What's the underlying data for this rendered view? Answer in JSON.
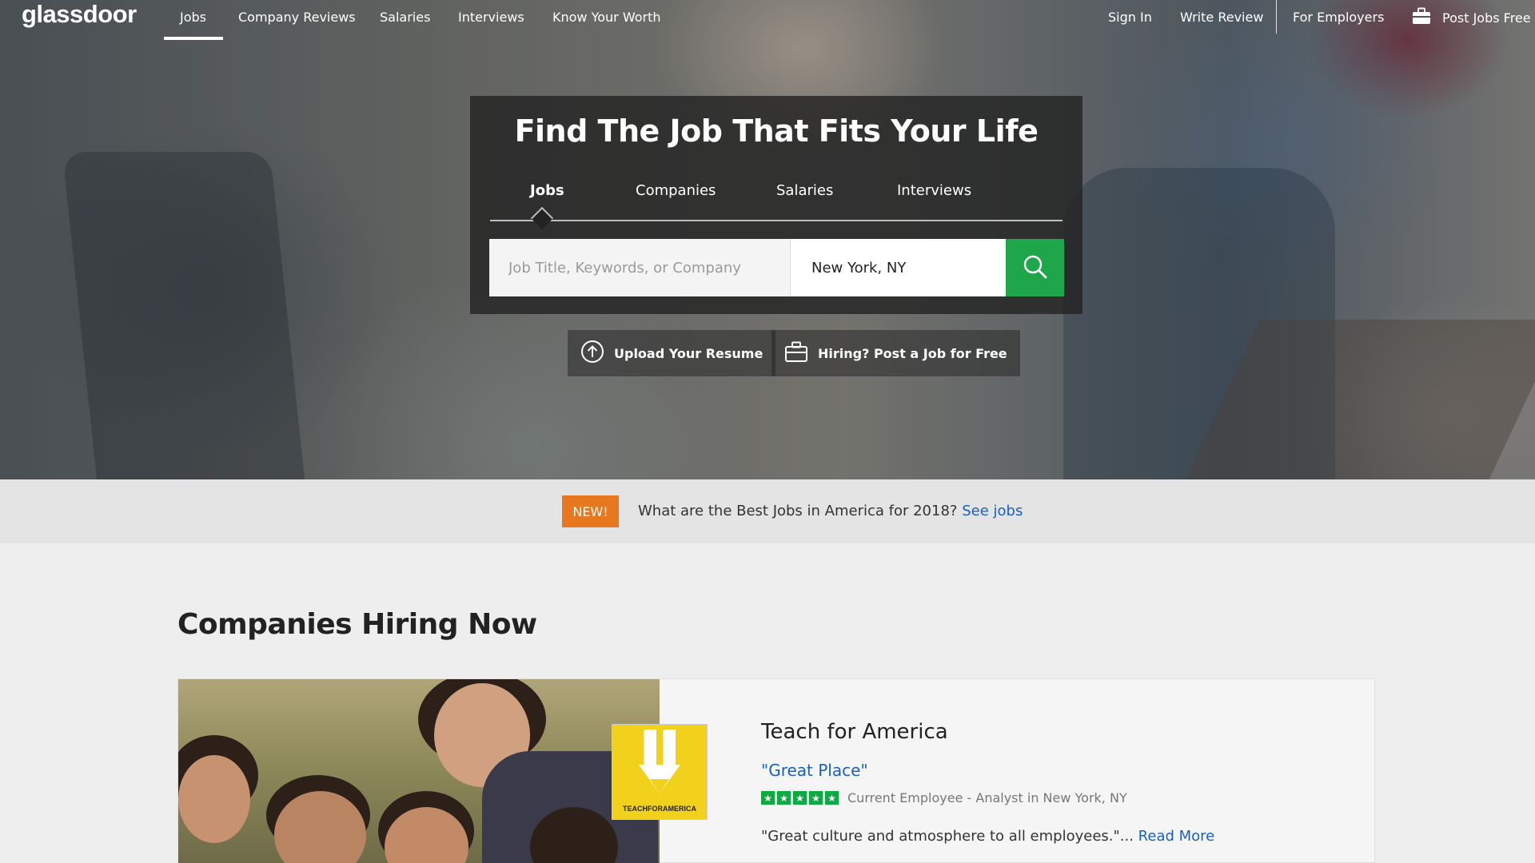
{
  "nav": {
    "logo": "glassdoor",
    "items": [
      "Jobs",
      "Company Reviews",
      "Salaries",
      "Interviews",
      "Know Your Worth"
    ],
    "active": "Jobs",
    "sign_in": "Sign In",
    "write_review": "Write Review",
    "for_employers": "For Employers",
    "post_jobs": "Post Jobs Free"
  },
  "hero": {
    "title": "Find The Job That Fits Your Life",
    "tabs": [
      "Jobs",
      "Companies",
      "Salaries",
      "Interviews"
    ],
    "active_tab": "Jobs",
    "search": {
      "keyword_placeholder": "Job Title, Keywords, or Company",
      "location_value": "New York, NY"
    },
    "upload_resume": "Upload Your Resume",
    "post_job": "Hiring? Post a Job for Free"
  },
  "banner": {
    "badge": "NEW!",
    "text": "What are the Best Jobs in America for 2018?",
    "link": "See jobs"
  },
  "companies": {
    "section_title": "Companies Hiring Now",
    "card": {
      "company_name": "Teach for America",
      "logo_caption": "TEACHFORAMERICA",
      "review_title": "\"Great Place\"",
      "rating": 5,
      "reviewer": "Current Employee - Analyst in New York, NY",
      "review_text": "\"Great culture and atmosphere to all employees.\"...",
      "read_more": "Read More"
    }
  },
  "colors": {
    "accent_green": "#1fa64a",
    "star_green": "#0caa41",
    "badge_orange": "#e7781d",
    "link_blue": "#1861bf",
    "logo_yellow": "#f2d11d"
  }
}
